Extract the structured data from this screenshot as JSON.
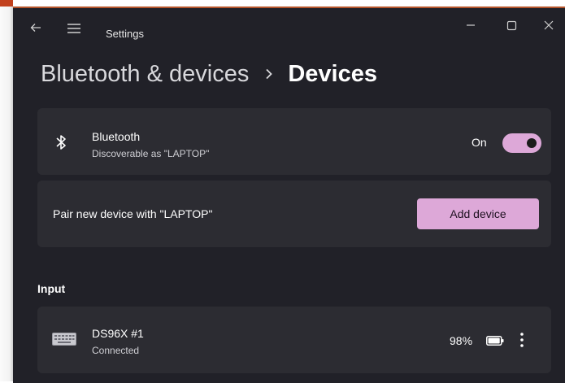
{
  "window": {
    "title": "Settings"
  },
  "breadcrumb": {
    "parent": "Bluetooth & devices",
    "current": "Devices"
  },
  "bluetooth": {
    "title": "Bluetooth",
    "subtitle": "Discoverable as \"LAPTOP\"",
    "state_label": "On",
    "enabled": true
  },
  "pair": {
    "label": "Pair new device with \"LAPTOP\"",
    "button": "Add device"
  },
  "section": {
    "title": "Input"
  },
  "device": {
    "name": "DS96X #1",
    "status": "Connected",
    "battery": "98%",
    "battery_level": 0.98
  },
  "colors": {
    "accent": "#dda8d8",
    "window_bg": "#212128",
    "card_bg": "#2c2c32",
    "text": "#ffffff"
  },
  "icons": [
    "back-arrow-icon",
    "hamburger-menu-icon",
    "minimize-icon",
    "maximize-icon",
    "close-icon",
    "chevron-right-icon",
    "bluetooth-icon",
    "keyboard-icon",
    "battery-icon",
    "more-options-icon"
  ]
}
